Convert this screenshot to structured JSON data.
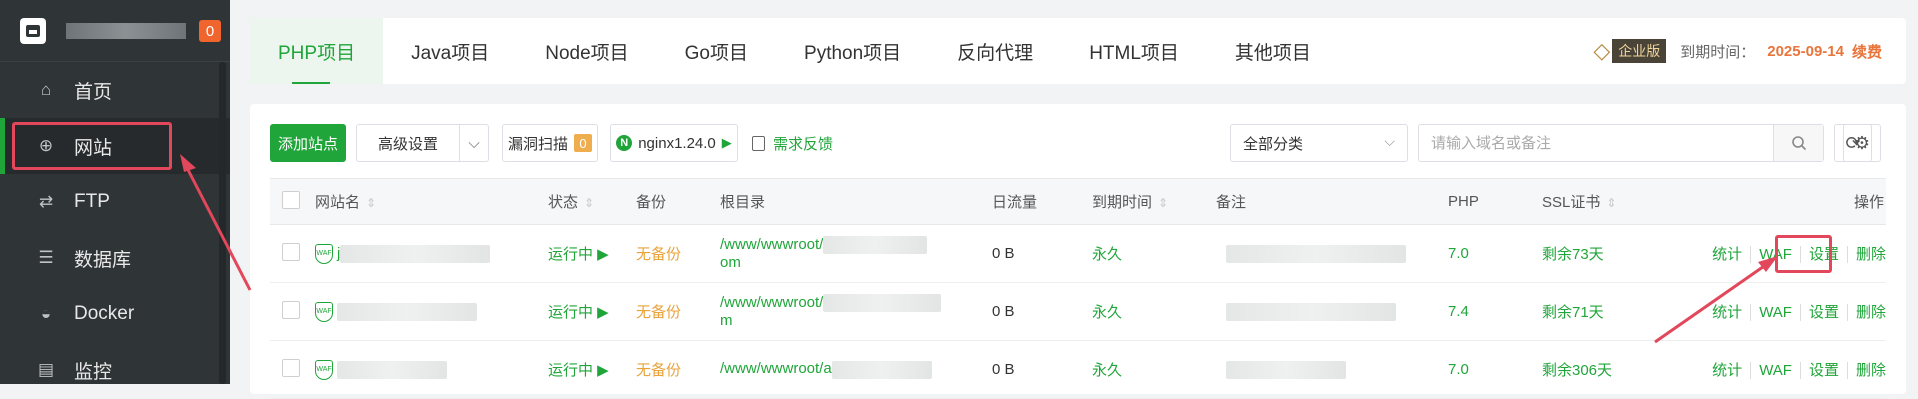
{
  "sidebar": {
    "badge": "0",
    "items": [
      {
        "label": "首页",
        "icon": "home-icon"
      },
      {
        "label": "网站",
        "icon": "globe-icon"
      },
      {
        "label": "FTP",
        "icon": "ftp-icon"
      },
      {
        "label": "数据库",
        "icon": "database-icon"
      },
      {
        "label": "Docker",
        "icon": "docker-icon"
      },
      {
        "label": "监控",
        "icon": "monitor-icon"
      }
    ]
  },
  "tabs": [
    "PHP项目",
    "Java项目",
    "Node项目",
    "Go项目",
    "Python项目",
    "反向代理",
    "HTML项目",
    "其他项目"
  ],
  "enterprise": {
    "tag": "企业版",
    "expire_label": "到期时间：",
    "expire_date": "2025-09-14",
    "renew": "续费"
  },
  "toolbar": {
    "add_site": "添加站点",
    "advanced": "高级设置",
    "scan": "漏洞扫描",
    "scan_count": "0",
    "nginx": "nginx1.24.0",
    "feedback": "需求反馈",
    "category": "全部分类",
    "search_placeholder": "请输入域名或备注"
  },
  "table": {
    "headers": {
      "name": "网站名",
      "status": "状态",
      "backup": "备份",
      "root": "根目录",
      "traffic": "日流量",
      "expire": "到期时间",
      "note": "备注",
      "php": "PHP",
      "ssl": "SSL证书",
      "ops": "操作"
    },
    "rows": [
      {
        "name": "j",
        "status": "运行中",
        "backup": "无备份",
        "root_line1": "/www/wwwroot/",
        "root_line2": "om",
        "traffic": "0 B",
        "expire": "永久",
        "php": "7.0",
        "ssl": "剩余73天"
      },
      {
        "name": "",
        "status": "运行中",
        "backup": "无备份",
        "root_line1": "/www/wwwroot/",
        "root_line2": "m",
        "traffic": "0 B",
        "expire": "永久",
        "php": "7.4",
        "ssl": "剩余71天"
      },
      {
        "name": "",
        "status": "运行中",
        "backup": "无备份",
        "root_line1": "/www/wwwroot/a",
        "root_line2": "",
        "traffic": "0 B",
        "expire": "永久",
        "php": "7.0",
        "ssl": "剩余306天"
      }
    ],
    "actions": [
      "统计",
      "WAF",
      "设置",
      "删除"
    ]
  },
  "colors": {
    "accent": "#20a53a",
    "warn": "#e8a33a",
    "highlight": "#e2475b"
  }
}
